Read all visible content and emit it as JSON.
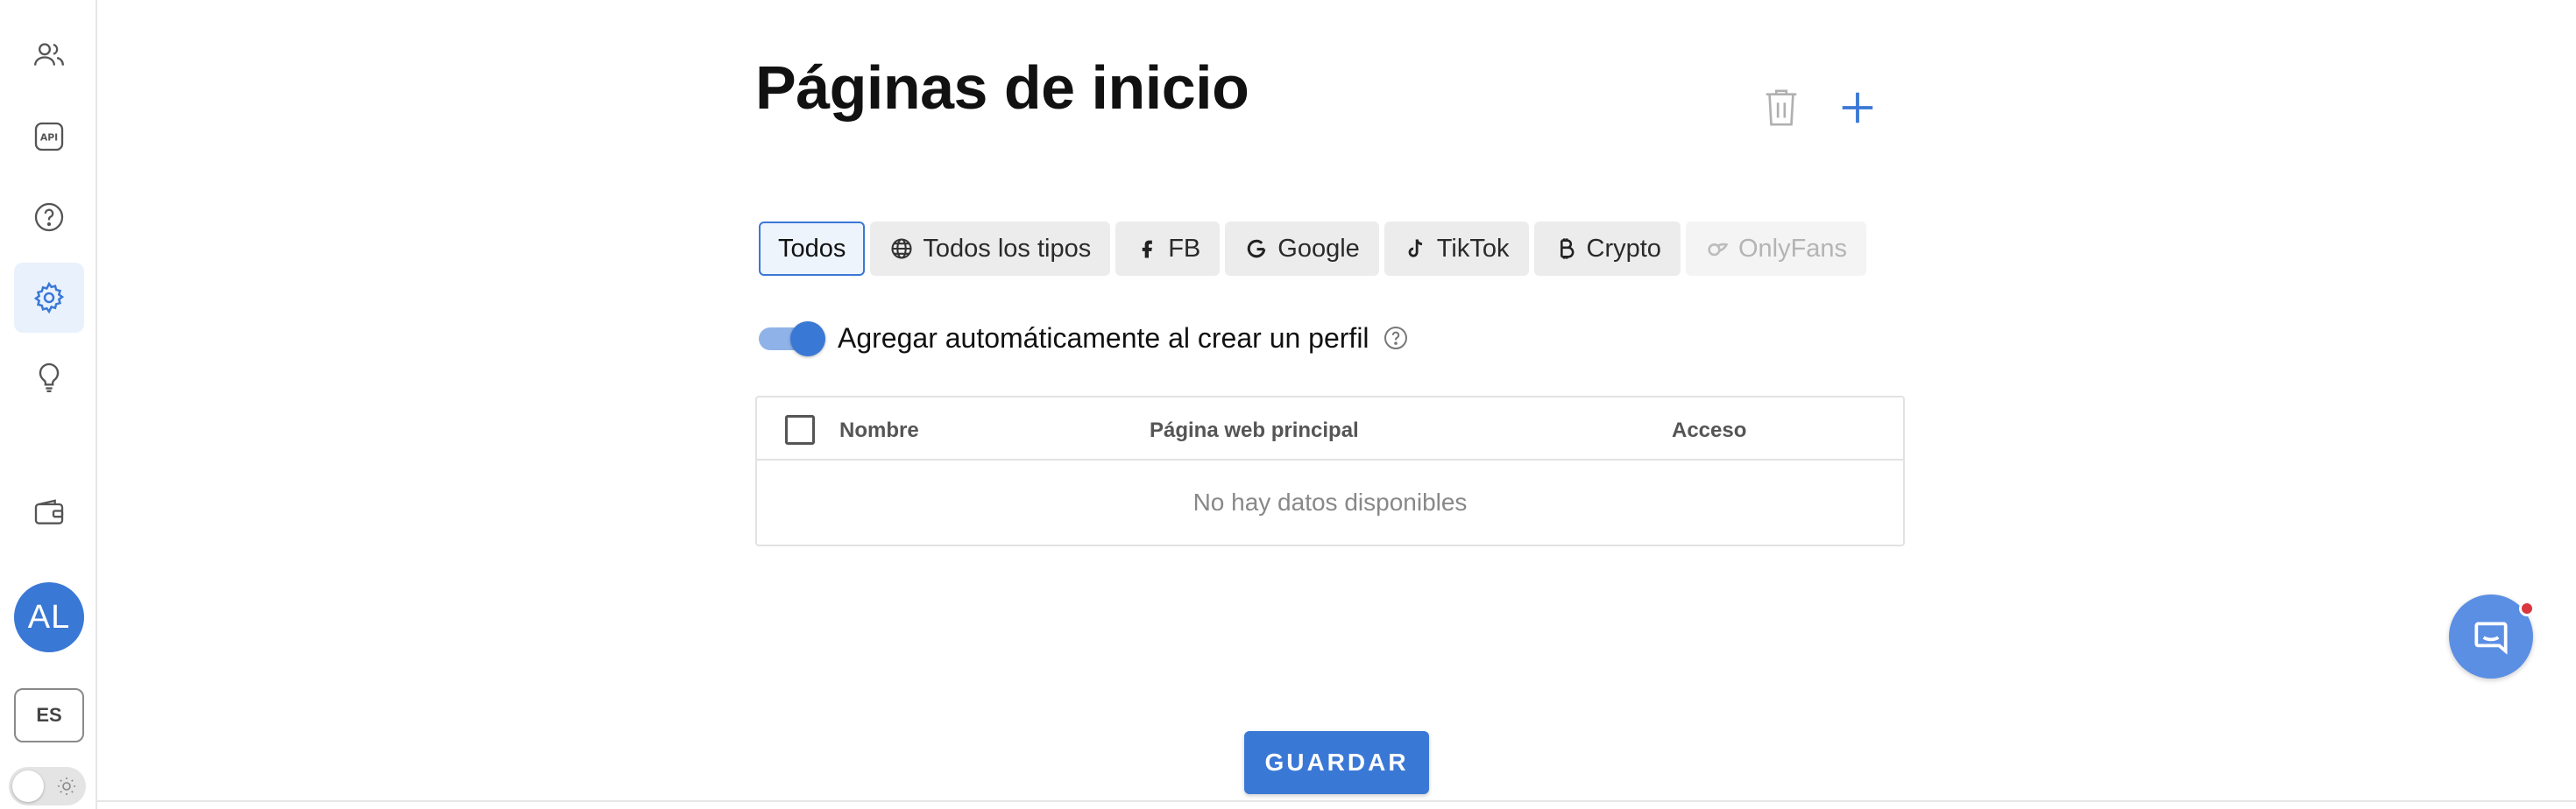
{
  "sidebar": {
    "items": [
      {
        "icon": "users-icon"
      },
      {
        "icon": "api-icon",
        "label": "API"
      },
      {
        "icon": "help-icon"
      },
      {
        "icon": "gear-icon",
        "active": true
      },
      {
        "icon": "lightbulb-icon"
      },
      {
        "icon": "wallet-icon"
      }
    ],
    "avatar_initials": "AL",
    "language": "ES"
  },
  "page": {
    "title": "Páginas de inicio"
  },
  "filters": [
    {
      "label": "Todos",
      "icon": "",
      "selected": true
    },
    {
      "label": "Todos los tipos",
      "icon": "globe-icon"
    },
    {
      "label": "FB",
      "icon": "facebook-icon"
    },
    {
      "label": "Google",
      "icon": "google-icon"
    },
    {
      "label": "TikTok",
      "icon": "tiktok-icon"
    },
    {
      "label": "Crypto",
      "icon": "bitcoin-icon"
    },
    {
      "label": "OnlyFans",
      "icon": "onlyfans-icon",
      "disabled": true
    }
  ],
  "auto_add": {
    "label": "Agregar automáticamente al crear un perfil",
    "enabled": true
  },
  "table": {
    "columns": [
      "Nombre",
      "Página web principal",
      "Acceso"
    ],
    "empty_text": "No hay datos disponibles"
  },
  "actions": {
    "save_label": "GUARDAR"
  },
  "colors": {
    "accent": "#3a78d6",
    "chat": "#5b8fe4",
    "notification": "#d9363e"
  }
}
